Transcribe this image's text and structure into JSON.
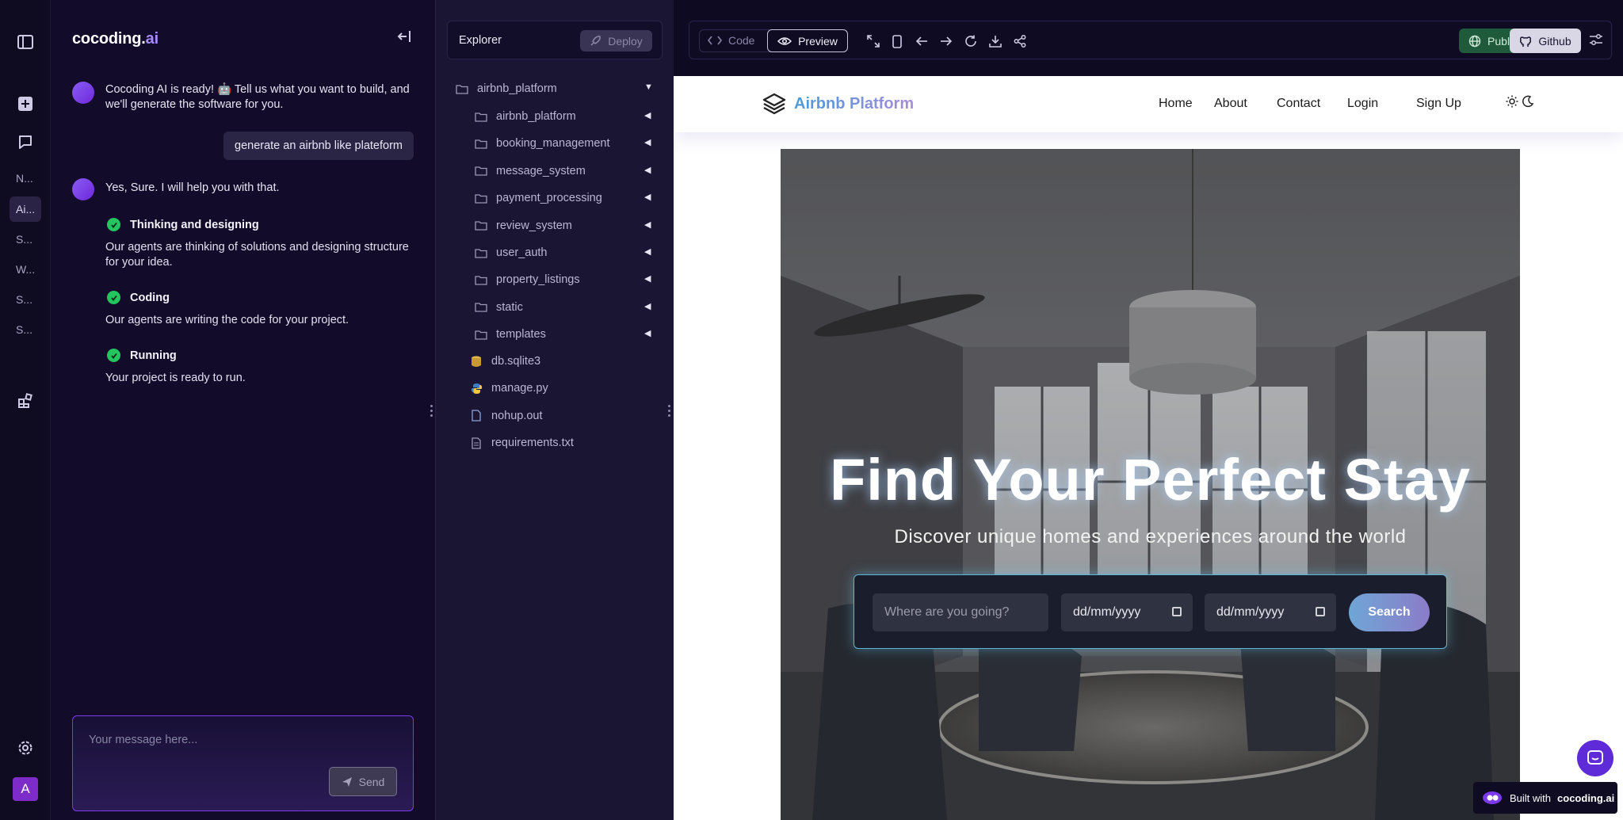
{
  "rail": {
    "recent_chats": [
      "N...",
      "Ai...",
      "S...",
      "W...",
      "S...",
      "S..."
    ],
    "avatar_letter": "A"
  },
  "chat": {
    "brand_main": "cocoding.",
    "brand_ai": "ai",
    "intro": "Cocoding AI is ready! 🤖 Tell us what you want to build, and we'll generate the software for you.",
    "user_message": "generate an airbnb like plateform",
    "reply": "Yes, Sure. I will help you with that.",
    "steps": [
      {
        "title": "Thinking and designing",
        "desc": "Our agents are thinking of solutions and designing structure for your idea."
      },
      {
        "title": "Coding",
        "desc": "Our agents are writing the code for your project."
      },
      {
        "title": "Running",
        "desc": "Your project is ready to run."
      }
    ],
    "input_placeholder": "Your message here...",
    "send_label": "Send"
  },
  "explorer": {
    "title": "Explorer",
    "deploy_label": "Deploy",
    "root": "airbnb_platform",
    "folders": [
      "airbnb_platform",
      "booking_management",
      "message_system",
      "payment_processing",
      "review_system",
      "user_auth",
      "property_listings",
      "static",
      "templates"
    ],
    "files": [
      "db.sqlite3",
      "manage.py",
      "nohup.out",
      "requirements.txt"
    ]
  },
  "toolbar": {
    "code_label": "Code",
    "preview_label": "Preview",
    "publish_label": "Publish",
    "github_label": "Github"
  },
  "site": {
    "logo_text": "Airbnb Platform",
    "nav": [
      "Home",
      "About",
      "Contact",
      "Login",
      "Sign Up"
    ],
    "hero_title": "Find Your Perfect Stay",
    "hero_subtitle": "Discover unique homes and experiences around the world",
    "where_placeholder": "Where are you going?",
    "date_placeholder": "dd/mm/yyyy",
    "search_label": "Search"
  },
  "badge": {
    "prefix": "Built with",
    "brand": "cocoding.ai"
  }
}
